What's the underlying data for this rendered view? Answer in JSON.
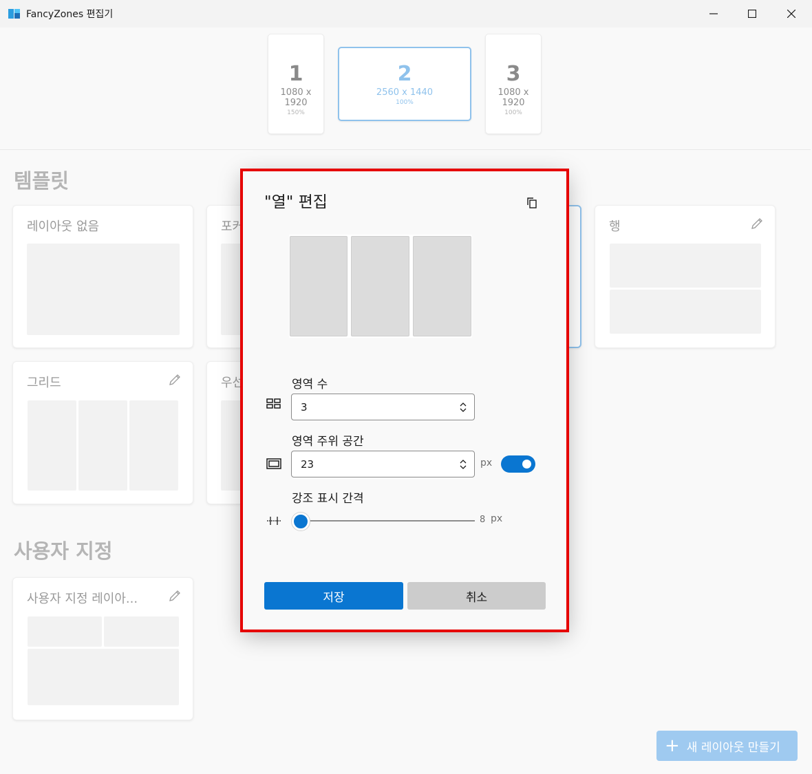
{
  "window": {
    "title": "FancyZones 편집기"
  },
  "monitors": [
    {
      "number": "1",
      "resolution": "1080 x 1920",
      "scale": "150%",
      "selected": false
    },
    {
      "number": "2",
      "resolution": "2560 x 1440",
      "scale": "100%",
      "selected": true
    },
    {
      "number": "3",
      "resolution": "1080 x 1920",
      "scale": "100%",
      "selected": false
    }
  ],
  "templates": {
    "heading": "템플릿",
    "cards": [
      {
        "title": "레이아웃 없음"
      },
      {
        "title": "포커"
      },
      {
        "title": "행"
      },
      {
        "title": "그리드"
      },
      {
        "title": "우선"
      }
    ]
  },
  "custom": {
    "heading": "사용자 지정",
    "cards": [
      {
        "title": "사용자 지정 레이아..."
      }
    ]
  },
  "new_layout_button": {
    "label": "새 레이아웃 만들기"
  },
  "dialog": {
    "title": "\"열\" 편집",
    "zone_count": {
      "label": "영역 수",
      "value": "3"
    },
    "space_around": {
      "label": "영역 주위 공간",
      "value": "23",
      "unit": "px",
      "enabled": true
    },
    "highlight_distance": {
      "label": "강조 표시 간격",
      "value": "8",
      "unit": "px",
      "level_fraction": 0.0
    },
    "save_label": "저장",
    "cancel_label": "취소"
  },
  "colors": {
    "accent": "#0a76d1",
    "accent_light": "#8fc2ec",
    "highlight_frame": "#e60000"
  }
}
